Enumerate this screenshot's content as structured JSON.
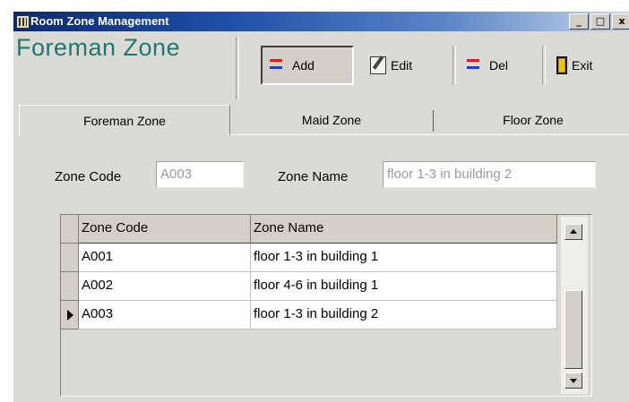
{
  "window": {
    "title": "Room Zone Management",
    "icon": "app-grid-icon",
    "controls": [
      "_",
      "□",
      "x"
    ]
  },
  "header": {
    "zone_title": "Foreman Zone"
  },
  "toolbar": {
    "add_label": "Add",
    "edit_label": "Edit",
    "del_label": "Del",
    "exit_label": "Exit",
    "icons": {
      "add": "add-record-icon",
      "edit": "edit-record-icon",
      "del": "delete-record-icon",
      "exit": "exit-door-icon"
    }
  },
  "tabs": [
    {
      "label": "Foreman Zone",
      "active": true
    },
    {
      "label": "Maid Zone",
      "active": false
    },
    {
      "label": "Floor Zone",
      "active": false
    }
  ],
  "form": {
    "zone_code_label": "Zone Code",
    "zone_code_value": "A003",
    "zone_name_label": "Zone Name",
    "zone_name_value": "floor 1-3 in building 2"
  },
  "grid": {
    "columns": [
      "Zone Code",
      "Zone Name"
    ],
    "rows": [
      {
        "code": "A001",
        "name": "floor 1-3 in building 1"
      },
      {
        "code": "A002",
        "name": "floor 4-6 in building 1"
      },
      {
        "code": "A003",
        "name": "floor 1-3 in building 2"
      }
    ],
    "selected_row": 2
  },
  "colors": {
    "zone_title": "#1e7874",
    "titlebar_start": "#0b2a6b",
    "panel_bg": "#dcdad5"
  }
}
